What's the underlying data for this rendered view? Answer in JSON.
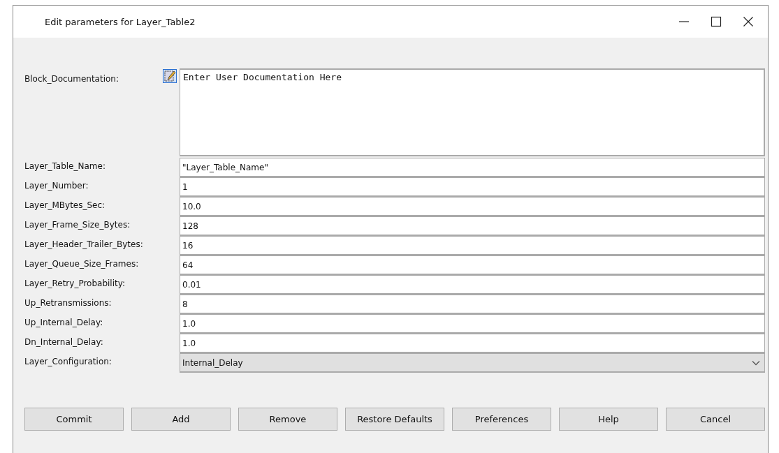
{
  "window": {
    "title": "Edit parameters for Layer_Table2"
  },
  "documentation": {
    "label": "Block_Documentation:",
    "value": "Enter User Documentation Here"
  },
  "parameters": [
    {
      "label": "Layer_Table_Name:",
      "value": "\"Layer_Table_Name\"",
      "kind": "text"
    },
    {
      "label": "Layer_Number:",
      "value": "1",
      "kind": "text"
    },
    {
      "label": "Layer_MBytes_Sec:",
      "value": "10.0",
      "kind": "text"
    },
    {
      "label": "Layer_Frame_Size_Bytes:",
      "value": "128",
      "kind": "text"
    },
    {
      "label": "Layer_Header_Trailer_Bytes:",
      "value": "16",
      "kind": "text"
    },
    {
      "label": "Layer_Queue_Size_Frames:",
      "value": "64",
      "kind": "text"
    },
    {
      "label": "Layer_Retry_Probability:",
      "value": "0.01",
      "kind": "text"
    },
    {
      "label": "Up_Retransmissions:",
      "value": "8",
      "kind": "text"
    },
    {
      "label": "Up_Internal_Delay:",
      "value": "1.0",
      "kind": "text"
    },
    {
      "label": "Dn_Internal_Delay:",
      "value": "1.0",
      "kind": "text"
    },
    {
      "label": "Layer_Configuration:",
      "value": "Internal_Delay",
      "kind": "dropdown"
    }
  ],
  "buttons": [
    "Commit",
    "Add",
    "Remove",
    "Restore Defaults",
    "Preferences",
    "Help",
    "Cancel"
  ]
}
